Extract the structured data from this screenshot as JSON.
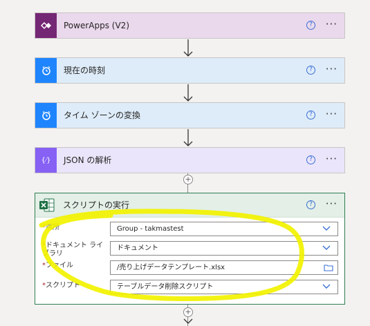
{
  "flow": {
    "steps": [
      {
        "title": "PowerApps (V2)",
        "icon": "powerapps-icon",
        "color": "#742774",
        "bg": "#ead8ec",
        "help": "?",
        "more": "···"
      },
      {
        "title": "現在の時刻",
        "icon": "alarm-clock-icon",
        "color": "#1f85ff",
        "bg": "#deecf9",
        "help": "?",
        "more": "···"
      },
      {
        "title": "タイム ゾーンの変換",
        "icon": "alarm-clock-icon",
        "color": "#1f85ff",
        "bg": "#deecf9",
        "help": "?",
        "more": "···"
      },
      {
        "title": "JSON の解析",
        "icon": "json-braces-icon",
        "color": "#8661f4",
        "bg": "#ebe5fb",
        "help": "?",
        "more": "···"
      }
    ],
    "script_step": {
      "title": "スクリプトの実行",
      "icon": "excel-icon",
      "color": "#1e7145",
      "help": "?",
      "more": "···",
      "fields": [
        {
          "label": "場所",
          "value": "Group - takmastest"
        },
        {
          "label": "ドキュメント ライブラリ",
          "value": "ドキュメント"
        },
        {
          "label": "ファイル",
          "value": "/売り上げデータテンプレート.xlsx"
        },
        {
          "label": "スクリプト",
          "value": "テーブルデータ削除スクリプト"
        }
      ]
    },
    "add_symbol": "+",
    "required_mark": "*",
    "highlight_color": "#f2f200"
  }
}
